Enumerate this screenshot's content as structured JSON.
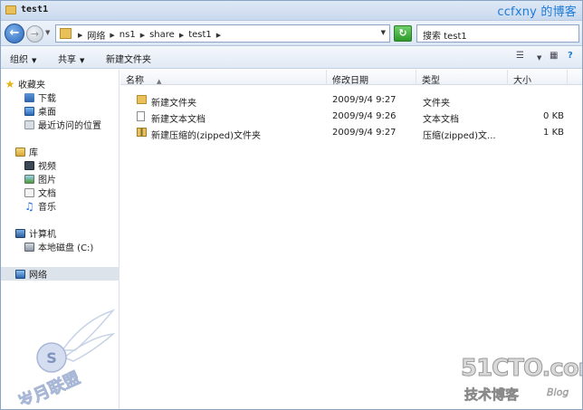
{
  "window": {
    "title": "test1",
    "watermark_top": "ccfxny 的博客"
  },
  "address": {
    "crumbs": [
      "网络",
      "ns1",
      "share",
      "test1"
    ],
    "search_placeholder": "搜索 test1"
  },
  "toolbar": {
    "organize": "组织",
    "share": "共享",
    "new_folder": "新建文件夹"
  },
  "sidebar": {
    "favorites": {
      "label": "收藏夹",
      "items": [
        "下载",
        "桌面",
        "最近访问的位置"
      ]
    },
    "libraries": {
      "label": "库",
      "items": [
        "视频",
        "图片",
        "文档",
        "音乐"
      ]
    },
    "computer": {
      "label": "计算机",
      "items": [
        "本地磁盘 (C:)"
      ]
    },
    "network": {
      "label": "网络"
    }
  },
  "columns": [
    "名称",
    "修改日期",
    "类型",
    "大小"
  ],
  "files": [
    {
      "name": "新建文件夹",
      "date": "2009/9/4 9:27",
      "type": "文件夹",
      "size": "",
      "icon": "folder-icon"
    },
    {
      "name": "新建文本文档",
      "date": "2009/9/4 9:26",
      "type": "文本文档",
      "size": "0 KB",
      "icon": "text-file-icon"
    },
    {
      "name": "新建压缩的(zipped)文件夹",
      "date": "2009/9/4 9:27",
      "type": "压缩(zipped)文...",
      "size": "1 KB",
      "icon": "zip-folder-icon"
    }
  ],
  "watermarks": {
    "site_en": "51CTO.com",
    "site_cn": "技术博客",
    "site_blog": "Blog"
  }
}
